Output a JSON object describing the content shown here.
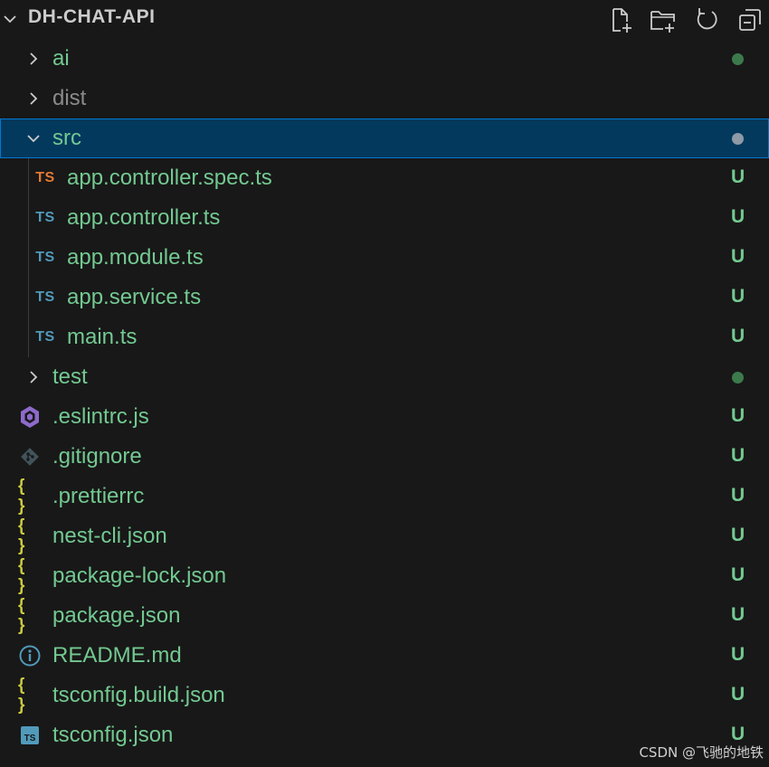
{
  "explorer": {
    "title": "DH-CHAT-API",
    "actions": [
      {
        "name": "new-file-icon"
      },
      {
        "name": "new-folder-icon"
      },
      {
        "name": "refresh-icon"
      },
      {
        "name": "collapse-all-icon"
      }
    ]
  },
  "tree": [
    {
      "label": "ai",
      "kind": "folder",
      "expanded": false,
      "level": 0,
      "decoration": "dot",
      "labelColor": "green"
    },
    {
      "label": "dist",
      "kind": "folder",
      "expanded": false,
      "level": 0,
      "decoration": "none",
      "labelColor": "dim"
    },
    {
      "label": "src",
      "kind": "folder",
      "expanded": true,
      "level": 0,
      "decoration": "dot",
      "labelColor": "green",
      "selected": true
    },
    {
      "label": "app.controller.spec.ts",
      "kind": "ts-test",
      "level": 1,
      "decoration": "U",
      "labelColor": "green"
    },
    {
      "label": "app.controller.ts",
      "kind": "ts",
      "level": 1,
      "decoration": "U",
      "labelColor": "green"
    },
    {
      "label": "app.module.ts",
      "kind": "ts",
      "level": 1,
      "decoration": "U",
      "labelColor": "green"
    },
    {
      "label": "app.service.ts",
      "kind": "ts",
      "level": 1,
      "decoration": "U",
      "labelColor": "green"
    },
    {
      "label": "main.ts",
      "kind": "ts",
      "level": 1,
      "decoration": "U",
      "labelColor": "green"
    },
    {
      "label": "test",
      "kind": "folder",
      "expanded": false,
      "level": 0,
      "decoration": "dot",
      "labelColor": "green"
    },
    {
      "label": ".eslintrc.js",
      "kind": "eslint",
      "level": 0,
      "decoration": "U",
      "labelColor": "green"
    },
    {
      "label": ".gitignore",
      "kind": "git",
      "level": 0,
      "decoration": "U",
      "labelColor": "green"
    },
    {
      "label": ".prettierrc",
      "kind": "json",
      "level": 0,
      "decoration": "U",
      "labelColor": "green"
    },
    {
      "label": "nest-cli.json",
      "kind": "json",
      "level": 0,
      "decoration": "U",
      "labelColor": "green"
    },
    {
      "label": "package-lock.json",
      "kind": "json",
      "level": 0,
      "decoration": "U",
      "labelColor": "green"
    },
    {
      "label": "package.json",
      "kind": "json",
      "level": 0,
      "decoration": "U",
      "labelColor": "green"
    },
    {
      "label": "README.md",
      "kind": "info",
      "level": 0,
      "decoration": "U",
      "labelColor": "green"
    },
    {
      "label": "tsconfig.build.json",
      "kind": "json",
      "level": 0,
      "decoration": "U",
      "labelColor": "green"
    },
    {
      "label": "tsconfig.json",
      "kind": "tsconfig",
      "level": 0,
      "decoration": "U",
      "labelColor": "green"
    }
  ],
  "icons": {
    "ts": {
      "text": "TS",
      "color": "#519aba"
    },
    "ts-test": {
      "text": "TS",
      "color": "#e37933"
    },
    "json": {
      "text": "{ }",
      "color": "#cbcb41"
    }
  },
  "colors": {
    "untracked": "#73c991",
    "selectionBg": "#04395e",
    "selectionBorder": "#0078d4"
  },
  "watermark": "CSDN @飞驰的地铁"
}
